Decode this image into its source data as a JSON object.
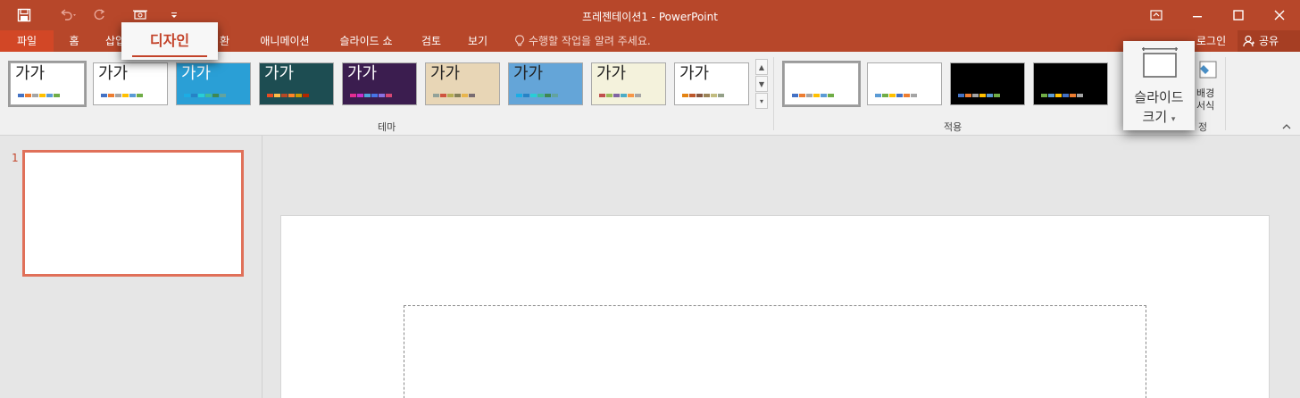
{
  "window": {
    "title": "프레젠테이션1 - PowerPoint",
    "signin": "로그인",
    "share": "공유"
  },
  "tabs": {
    "file": "파일",
    "home": "홈",
    "insert": "삽입",
    "design": "디자인",
    "transitions": "화면 전환",
    "transitions_visible": "환",
    "animations": "애니메이션",
    "slideshow": "슬라이드 쇼",
    "review": "검토",
    "view": "보기",
    "tellme": "수행할 작업을 알려 주세요."
  },
  "ribbon": {
    "themes_label": "테마",
    "variants_label": "적용",
    "customize_label": "설정",
    "customize_visible": "정",
    "theme_sample_text": "가가",
    "slide_size": {
      "line1": "슬라이드",
      "line2": "크기"
    },
    "background_format": {
      "line1": "배경",
      "line2": "서식",
      "visible1": "배경",
      "visible2": "서식"
    }
  },
  "themes": [
    {
      "bg": "#ffffff",
      "text": "#222222",
      "colors": [
        "#4472c4",
        "#ed7d31",
        "#a5a5a5",
        "#ffc000",
        "#5b9bd5",
        "#70ad47"
      ]
    },
    {
      "bg": "#ffffff",
      "text": "#222222",
      "colors": [
        "#4472c4",
        "#ed7d31",
        "#a5a5a5",
        "#ffc000",
        "#5b9bd5",
        "#70ad47"
      ]
    },
    {
      "bg": "#2a9fd6",
      "text": "#ffffff",
      "colors": [
        "#1cade4",
        "#2683c6",
        "#27ced7",
        "#42ba97",
        "#3e8853",
        "#62a39f"
      ]
    },
    {
      "bg": "#1d4d52",
      "text": "#ffffff",
      "colors": [
        "#e84c22",
        "#ffbd47",
        "#b64926",
        "#ff8427",
        "#cc9900",
        "#b22600"
      ]
    },
    {
      "bg": "#3b1d4f",
      "text": "#ffffff",
      "colors": [
        "#e32d91",
        "#c830cc",
        "#4ea6dc",
        "#4775e7",
        "#8971e1",
        "#d54773"
      ]
    },
    {
      "bg": "#e8d6b6",
      "text": "#222222",
      "colors": [
        "#93a299",
        "#cf543f",
        "#b5ae53",
        "#848058",
        "#e8b54d",
        "#786c71"
      ]
    },
    {
      "bg": "#64a5d8",
      "text": "#222222",
      "colors": [
        "#1cade4",
        "#2683c6",
        "#27ced7",
        "#42ba97",
        "#3e8853",
        "#62a39f"
      ]
    },
    {
      "bg": "#f4f2dc",
      "text": "#222222",
      "colors": [
        "#c0504d",
        "#9bbb59",
        "#8064a2",
        "#4bacc6",
        "#f79646",
        "#a5a5a5"
      ]
    },
    {
      "bg": "#ffffff",
      "text": "#222222",
      "colors": [
        "#e48312",
        "#bd582c",
        "#865640",
        "#9b8357",
        "#c2bc80",
        "#94a088"
      ]
    }
  ],
  "variants": [
    {
      "bg": "#ffffff",
      "colors": [
        "#4472c4",
        "#ed7d31",
        "#a5a5a5",
        "#ffc000",
        "#5b9bd5",
        "#70ad47"
      ]
    },
    {
      "bg": "#ffffff",
      "colors": [
        "#5b9bd5",
        "#70ad47",
        "#ffc000",
        "#4472c4",
        "#ed7d31",
        "#a5a5a5"
      ]
    },
    {
      "bg": "#000000",
      "colors": [
        "#4472c4",
        "#ed7d31",
        "#a5a5a5",
        "#ffc000",
        "#5b9bd5",
        "#70ad47"
      ]
    },
    {
      "bg": "#000000",
      "colors": [
        "#70ad47",
        "#5b9bd5",
        "#ffc000",
        "#4472c4",
        "#ed7d31",
        "#a5a5a5"
      ]
    }
  ],
  "slides": {
    "first_number": "1"
  },
  "colors": {
    "accent": "#b7472a",
    "accent_light": "#d24726",
    "highlight": "#c3432a"
  }
}
